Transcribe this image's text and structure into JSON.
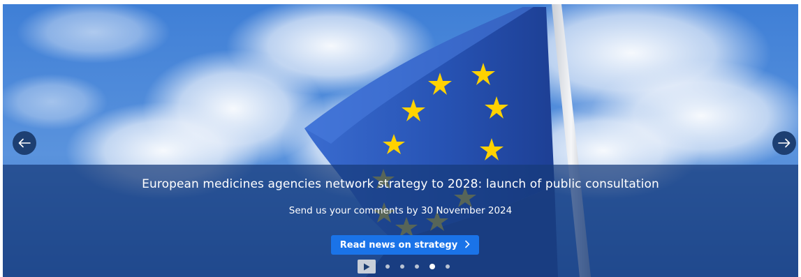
{
  "slide": {
    "headline": "European medicines agencies network strategy to 2028: launch of public consultation",
    "subheadline": "Send us your comments by 30 November 2024",
    "cta_label": "Read news on strategy",
    "cta_icon": "chevron-right-icon",
    "image": "eu-flag-on-pole-against-cloudy-blue-sky"
  },
  "nav": {
    "prev_icon": "arrow-left-icon",
    "next_icon": "arrow-right-icon"
  },
  "pager": {
    "play_icon": "play-icon",
    "total": 5,
    "active_index": 3
  },
  "colors": {
    "band": "#163a7a",
    "cta": "#1a73e8",
    "arrow_bg": "#1d3f72",
    "eu_blue": "#2d5fc0",
    "eu_star": "#ffd200"
  }
}
